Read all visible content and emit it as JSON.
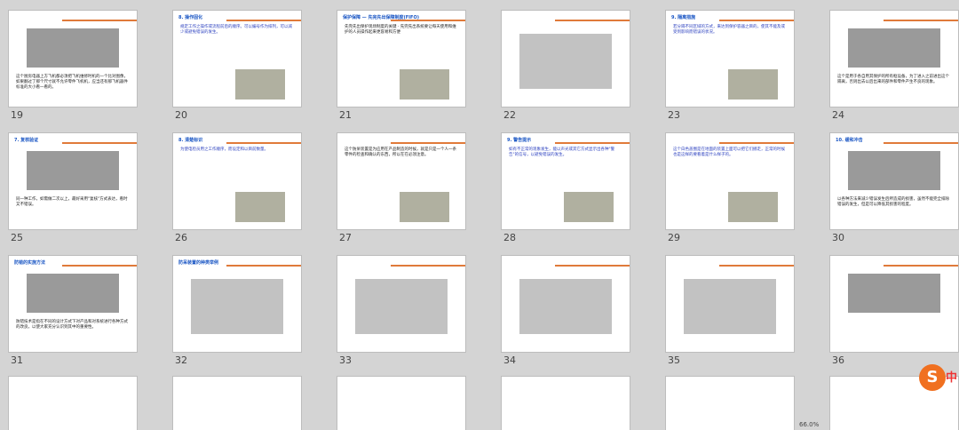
{
  "thumbnails": [
    {
      "number": "19",
      "title": "",
      "caption": "这个厨房电器上方飞机都必须把飞机维修时机的一个比对图像，如果翻过了那个尺寸就不允许零件飞机机，应当还有那飞机器件标准的大小看一看的。"
    },
    {
      "number": "20",
      "title": "8. 操作固化",
      "caption": "规定工作之操作或流程前后的顺序。可以编号作为排列，可以减少或避免错误的发生。"
    },
    {
      "number": "21",
      "title": "保护保障 — 先完先出保障制度(FIFO)",
      "caption": "先完先出保护现场制度的关键 · 先完先出系统要让每天使用和维护的人员操作起来更容易和方便"
    },
    {
      "number": "22",
      "title": "",
      "caption": ""
    },
    {
      "number": "23",
      "title": "9. 隔离措施",
      "caption": "若分隔不同区域的方式，来达到保护容器之目的，使其不能及或受到影响而错误的状况。"
    },
    {
      "number": "24",
      "title": "",
      "caption": "这个是用于各自用其保护的所有框设备，为了进入之前进出这个隔离，否则出去以后出来的部件和零件产生不良的现象。"
    },
    {
      "number": "25",
      "title": "7. 复核验证",
      "caption": "同一种工作，如需做二次以上，最好采用\"复核\"方式表达，看时又不错误。"
    },
    {
      "number": "26",
      "title": "8. 清楚标识",
      "caption": "为使电检员用之工作顺序，而设定和以目前数量。"
    },
    {
      "number": "27",
      "title": "",
      "caption": "这个防呆装置是为应用在产品制造的时候，就是只是一个人一条零件的检查和确认的东西，所以在在必须注意。"
    },
    {
      "number": "28",
      "title": "9. 警告提示",
      "caption": "如有不正常的现象发生，能以声光或其它方式显示出各种\"警告\"的信号，以避免错误的发生。"
    },
    {
      "number": "29",
      "title": "",
      "caption": "这个白色盖圈是在地面的装置上面可以把它们挪走，正常的时候也是这样的要看着是什么样子的。"
    },
    {
      "number": "30",
      "title": "10. 缓和冲击",
      "caption": "以各种方法来减少错误发生后所造成的损害，虽然不能完全排除错误的发生，但是可以降低其损害的程度。"
    },
    {
      "number": "31",
      "title": "防错的实施方法",
      "caption": "防错技术是指在不同的设计方式下对产品和对系统进行各种方式的改良，以使大家充分认识到其中的重要性。"
    },
    {
      "number": "32",
      "title": "防呆装置的种类举例",
      "caption": ""
    },
    {
      "number": "33",
      "title": "",
      "caption": ""
    },
    {
      "number": "34",
      "title": "",
      "caption": ""
    },
    {
      "number": "35",
      "title": "",
      "caption": ""
    },
    {
      "number": "36",
      "title": "",
      "caption": ""
    }
  ],
  "bottom_status": "66.0%",
  "ime_badge": "S",
  "ime_label": "中"
}
